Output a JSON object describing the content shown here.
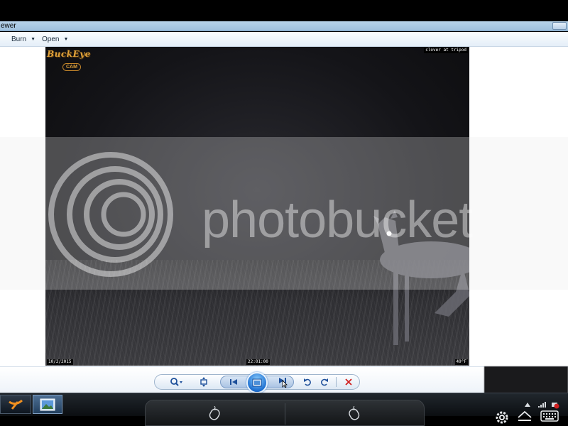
{
  "window": {
    "title": "ewer"
  },
  "menu": {
    "items": [
      {
        "label": "Burn",
        "caret": "▼"
      },
      {
        "label": "Open",
        "caret": "▼"
      }
    ]
  },
  "photo": {
    "brand_line1": "BuckEye",
    "brand_line2": "CAM",
    "caption": "clover at tripod",
    "date": "10/2/2015",
    "time": "22:01:00",
    "temperature": "49°F"
  },
  "watermark": {
    "text": "photobucket"
  },
  "controls": {
    "icons": [
      "zoom-icon",
      "fit-to-window-icon",
      "previous-icon",
      "slideshow-icon",
      "next-icon",
      "rotate-counterclockwise-icon",
      "rotate-clockwise-icon",
      "delete-icon"
    ],
    "accent": "#1d6fd0",
    "delete_color": "#d02020"
  },
  "taskbar": {
    "icons": [
      "start-icon",
      "photo-viewer-app-icon",
      "mouse-left-click-icon",
      "mouse-right-click-icon",
      "settings-icon",
      "eject-icon",
      "keyboard-icon",
      "tray-arrow-icon",
      "signal-icon",
      "status-icon"
    ]
  }
}
